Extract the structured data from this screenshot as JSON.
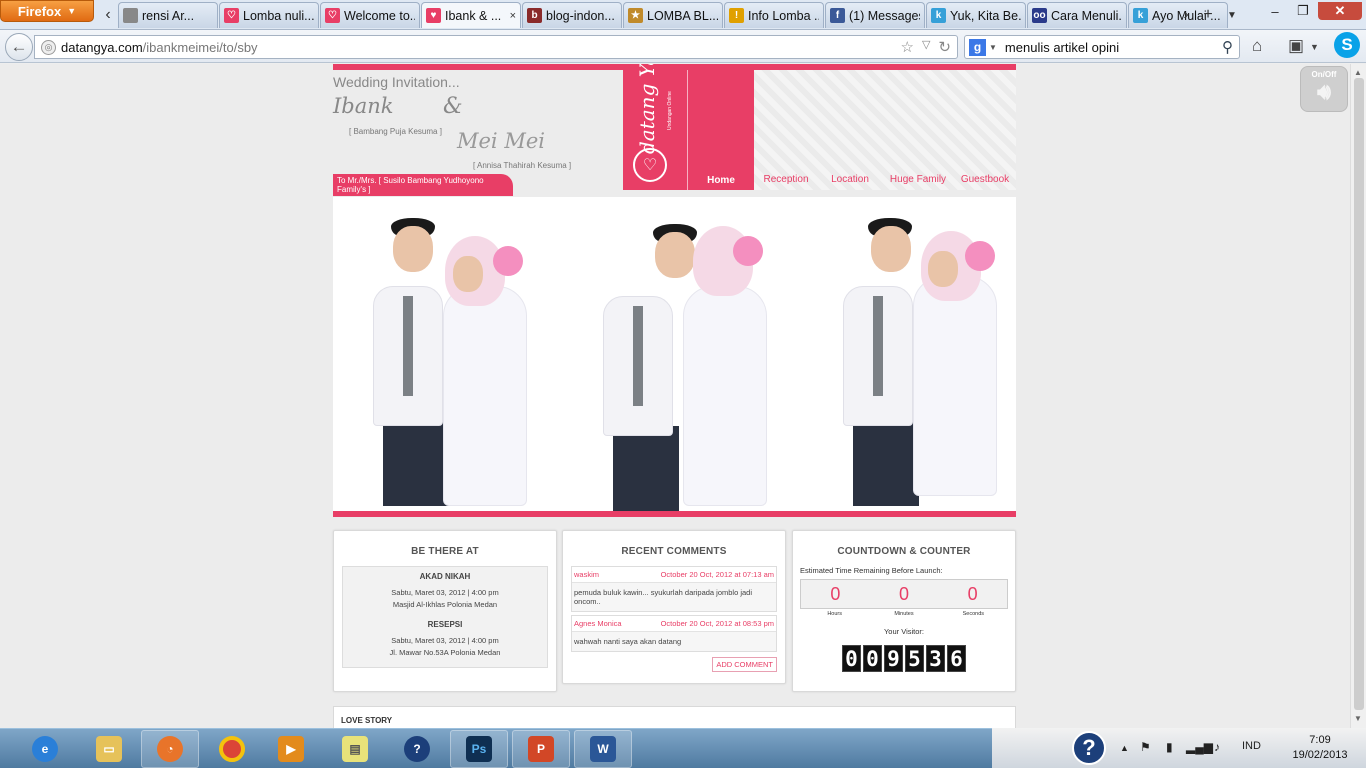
{
  "browser": {
    "menu_label": "Firefox",
    "tabs": [
      {
        "label": "rensi Ar...",
        "color": "#888888",
        "glyph": ""
      },
      {
        "label": "Lomba nuli...",
        "color": "#e83e66",
        "glyph": "♡"
      },
      {
        "label": "Welcome to...",
        "color": "#e83e66",
        "glyph": "♡"
      },
      {
        "label": "Ibank & ...",
        "color": "#e83e66",
        "glyph": "♥"
      },
      {
        "label": "blog-indon...",
        "color": "#8a2a2a",
        "glyph": "b"
      },
      {
        "label": "LOMBA BL...",
        "color": "#c08a2a",
        "glyph": "★"
      },
      {
        "label": "Info Lomba ...",
        "color": "#e0a000",
        "glyph": "!"
      },
      {
        "label": "(1) Messages",
        "color": "#3b5998",
        "glyph": "f"
      },
      {
        "label": "Yuk, Kita Be...",
        "color": "#36a0d8",
        "glyph": "k"
      },
      {
        "label": "Cara Menuli...",
        "color": "#2a3a8a",
        "glyph": "oo"
      },
      {
        "label": "Ayo Mulai ...",
        "color": "#36a0d8",
        "glyph": "k"
      }
    ],
    "url_host": "datangya.com",
    "url_path": "/ibankmeimei/to/sby",
    "search_value": "menulis artikel opini"
  },
  "site": {
    "heading": "Wedding Invitation...",
    "groom": "Ibank",
    "ampersand": "&",
    "groom_full": "[ Bambang Puja Kesuma ]",
    "bride": "Mei Mei",
    "bride_full": "[ Annisa Thahirah Kesuma ]",
    "to": "To Mr./Mrs. [ Susilo Bambang Yudhoyono Family's ]",
    "logo": "datang Ya",
    "logo_sub": "Undangan Online",
    "onoff": "On/Off",
    "menu": [
      "Home",
      "Reception",
      "Location",
      "Huge Family",
      "Guestbook"
    ]
  },
  "be_there": {
    "title": "BE THERE AT",
    "akad_title": "AKAD NIKAH",
    "akad_time": "Sabtu, Maret 03, 2012 | 4:00 pm",
    "akad_place": "Masjid Al-Ikhlas Polonia Medan",
    "resepsi_title": "RESEPSI",
    "resepsi_time": "Sabtu, Maret 03, 2012 | 4:00 pm",
    "resepsi_place": "Jl. Mawar No.53A Polonia Medan"
  },
  "comments": {
    "title": "RECENT COMMENTS",
    "items": [
      {
        "author": "waskim",
        "date": "October 20 Oct, 2012 at 07:13 am",
        "text": "pemuda buluk kawin... syukurlah daripada jomblo jadi oncom.."
      },
      {
        "author": "Agnes Monica",
        "date": "October 20 Oct, 2012 at 08:53 pm",
        "text": "wahwah nanti saya akan datang"
      }
    ],
    "add_label": "ADD COMMENT"
  },
  "countdown": {
    "title": "COUNTDOWN & COUNTER",
    "label": "Estimated Time Remaining Before Launch:",
    "hours": "0",
    "minutes": "0",
    "seconds": "0",
    "hours_cap": "Hours",
    "minutes_cap": "Minutes",
    "seconds_cap": "Seconds",
    "visitor_label": "Your Visitor:",
    "digits": [
      "0",
      "0",
      "9",
      "5",
      "3",
      "6"
    ]
  },
  "love_story": "LOVE STORY",
  "taskbar": {
    "lang": "IND",
    "time": "7:09",
    "date": "19/02/2013"
  },
  "colors": {
    "accent": "#e83e66"
  }
}
